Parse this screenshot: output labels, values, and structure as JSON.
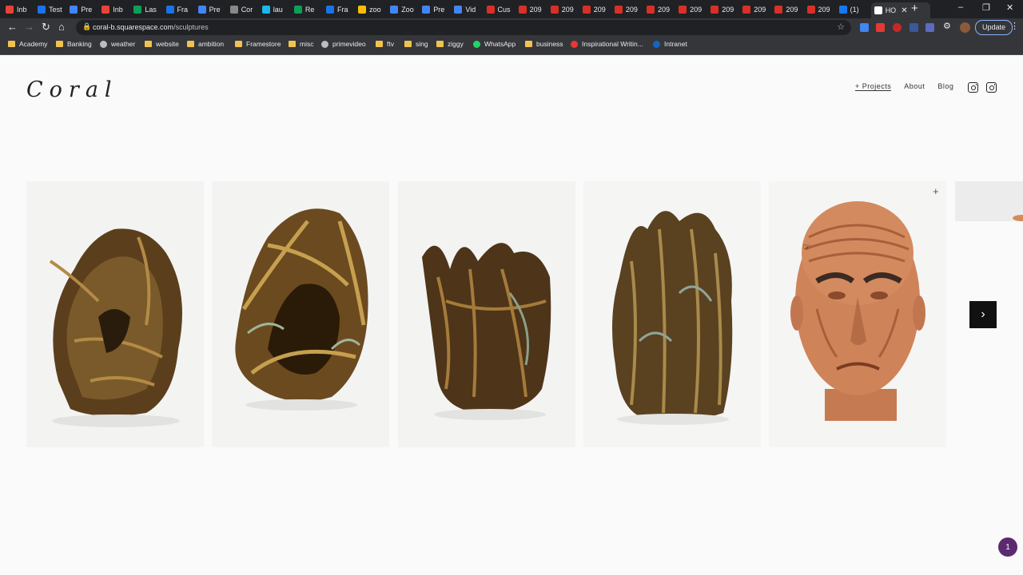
{
  "browser": {
    "tabs": [
      {
        "label": "Inb",
        "icon": "gmail-icon",
        "color": "#ea4335"
      },
      {
        "label": "Test",
        "icon": "generic-tab-icon",
        "color": "#1a73e8"
      },
      {
        "label": "Pre",
        "icon": "docs-icon",
        "color": "#4285f4"
      },
      {
        "label": "Inb",
        "icon": "gmail-icon",
        "color": "#ea4335"
      },
      {
        "label": "Las",
        "icon": "sheets-icon",
        "color": "#0f9d58"
      },
      {
        "label": "Fra",
        "icon": "generic-tab-icon",
        "color": "#1a73e8"
      },
      {
        "label": "Pre",
        "icon": "docs-icon",
        "color": "#4285f4"
      },
      {
        "label": "Cor",
        "icon": "squarespace-icon",
        "color": "#888888"
      },
      {
        "label": "lau",
        "icon": "vimeo-icon",
        "color": "#1ab7ea"
      },
      {
        "label": "Re",
        "icon": "sheets-icon",
        "color": "#0f9d58"
      },
      {
        "label": "Fra",
        "icon": "generic-tab-icon",
        "color": "#1a73e8"
      },
      {
        "label": "zoo",
        "icon": "drive-icon",
        "color": "#fbbc04"
      },
      {
        "label": "Zoo",
        "icon": "docs-icon",
        "color": "#4285f4"
      },
      {
        "label": "Pre",
        "icon": "docs-icon",
        "color": "#4285f4"
      },
      {
        "label": "Vid",
        "icon": "docs-icon",
        "color": "#4285f4"
      },
      {
        "label": "Cus",
        "icon": "c-icon",
        "color": "#d93025"
      },
      {
        "label": "209",
        "icon": "warning-icon",
        "color": "#d93025"
      },
      {
        "label": "209",
        "icon": "warning-icon",
        "color": "#d93025"
      },
      {
        "label": "209",
        "icon": "warning-icon",
        "color": "#d93025"
      },
      {
        "label": "209",
        "icon": "warning-icon",
        "color": "#d93025"
      },
      {
        "label": "209",
        "icon": "warning-icon",
        "color": "#d93025"
      },
      {
        "label": "209",
        "icon": "warning-icon",
        "color": "#d93025"
      },
      {
        "label": "209",
        "icon": "warning-icon",
        "color": "#d93025"
      },
      {
        "label": "209",
        "icon": "warning-icon",
        "color": "#d93025"
      },
      {
        "label": "209",
        "icon": "warning-icon",
        "color": "#d93025"
      },
      {
        "label": "209",
        "icon": "warning-icon",
        "color": "#d93025"
      },
      {
        "label": "(1)",
        "icon": "facebook-icon",
        "color": "#1877f2"
      },
      {
        "label": "HO",
        "icon": "generic-tab-icon",
        "color": "#ffffff"
      }
    ],
    "url_host": "coral-b.squarespace.com",
    "url_path": "/sculptures",
    "update_label": "Update",
    "bookmarks": [
      {
        "label": "Academy",
        "kind": "folder"
      },
      {
        "label": "Banking",
        "kind": "folder"
      },
      {
        "label": "weather",
        "kind": "link"
      },
      {
        "label": "website",
        "kind": "folder"
      },
      {
        "label": "ambition",
        "kind": "folder"
      },
      {
        "label": "Framestore",
        "kind": "folder"
      },
      {
        "label": "misc",
        "kind": "folder"
      },
      {
        "label": "primevideo",
        "kind": "link"
      },
      {
        "label": "ftv",
        "kind": "folder"
      },
      {
        "label": "sing",
        "kind": "folder"
      },
      {
        "label": "ziggy",
        "kind": "folder"
      },
      {
        "label": "WhatsApp",
        "kind": "link"
      },
      {
        "label": "business",
        "kind": "folder"
      },
      {
        "label": "Inspirational Writin...",
        "kind": "link"
      },
      {
        "label": "Intranet",
        "kind": "link"
      }
    ]
  },
  "site": {
    "logo": "Coral",
    "nav": {
      "projects": "+ Projects",
      "about": "About",
      "blog": "Blog"
    },
    "gallery_next_label": "›",
    "notification_count": "1"
  }
}
